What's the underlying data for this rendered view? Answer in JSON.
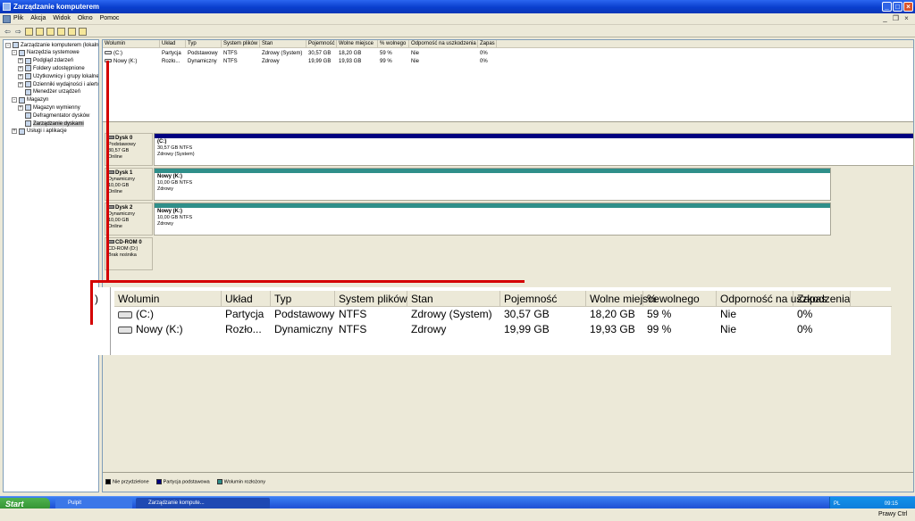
{
  "window": {
    "title": "Zarządzanie komputerem"
  },
  "menu": [
    "Plik",
    "Akcja",
    "Widok",
    "Okno",
    "Pomoc"
  ],
  "tree": [
    {
      "label": "Zarządzanie komputerem (lokalne)",
      "level": 0,
      "expander": "-"
    },
    {
      "label": "Narzędzia systemowe",
      "level": 1,
      "expander": "-"
    },
    {
      "label": "Podgląd zdarzeń",
      "level": 2,
      "expander": "+"
    },
    {
      "label": "Foldery udostępnione",
      "level": 2,
      "expander": "+"
    },
    {
      "label": "Użytkownicy i grupy lokalne",
      "level": 2,
      "expander": "+"
    },
    {
      "label": "Dzienniki wydajności i alertów",
      "level": 2,
      "expander": "+"
    },
    {
      "label": "Menedżer urządzeń",
      "level": 2,
      "expander": ""
    },
    {
      "label": "Magazyn",
      "level": 1,
      "expander": "-"
    },
    {
      "label": "Magazyn wymienny",
      "level": 2,
      "expander": "+"
    },
    {
      "label": "Defragmentator dysków",
      "level": 2,
      "expander": ""
    },
    {
      "label": "Zarządzanie dyskami",
      "level": 2,
      "expander": "",
      "selected": true
    },
    {
      "label": "Usługi i aplikacje",
      "level": 1,
      "expander": "+"
    }
  ],
  "volume_columns": [
    "Wolumin",
    "Układ",
    "Typ",
    "System plików",
    "Stan",
    "Pojemność",
    "Wolne miejsce",
    "% wolnego",
    "Odporność na uszkodzenia",
    "Zapas"
  ],
  "volumes": [
    [
      "(C:)",
      "Partycja",
      "Podstawowy",
      "NTFS",
      "Zdrowy (System)",
      "30,57 GB",
      "18,20 GB",
      "59 %",
      "Nie",
      "0%"
    ],
    [
      "Nowy (K:)",
      "Rozło...",
      "Dynamiczny",
      "NTFS",
      "Zdrowy",
      "19,99 GB",
      "19,93 GB",
      "99 %",
      "Nie",
      "0%"
    ]
  ],
  "disks": [
    {
      "name": "Dysk 0",
      "type": "Podstawowy",
      "size": "30,57 GB",
      "status": "Online",
      "part_title": "(C:)",
      "part_size": "30,57 GB NTFS",
      "part_status": "Zdrowy (System)",
      "bar_color": "#000080"
    },
    {
      "name": "Dysk 1",
      "type": "Dynamiczny",
      "size": "10,00 GB",
      "status": "Online",
      "part_title": "Nowy  (K:)",
      "part_size": "10,00 GB NTFS",
      "part_status": "Zdrowy",
      "bar_color": "#2f8f8a"
    },
    {
      "name": "Dysk 2",
      "type": "Dynamiczny",
      "size": "10,00 GB",
      "status": "Online",
      "part_title": "Nowy  (K:)",
      "part_size": "10,00 GB NTFS",
      "part_status": "Zdrowy",
      "bar_color": "#2f8f8a"
    },
    {
      "name": "CD-ROM 0",
      "type": "CD-ROM (D:)",
      "size": "",
      "status": "Brak nośnika"
    }
  ],
  "legend": [
    {
      "label": "Nie przydzielone",
      "color": "#000000"
    },
    {
      "label": "Partycja podstawowa",
      "color": "#000080"
    },
    {
      "label": "Wolumin rozłożony",
      "color": "#2f8f8a"
    }
  ],
  "zoom": {
    "left_glyph": ")",
    "columns": [
      "Wolumin",
      "Układ",
      "Typ",
      "System plików",
      "Stan",
      "Pojemność",
      "Wolne miejsce",
      "% wolnego",
      "Odporność na uszkodzenia",
      "Zapas"
    ],
    "rows": [
      [
        "(C:)",
        "Partycja",
        "Podstawowy",
        "NTFS",
        "Zdrowy (System)",
        "30,57 GB",
        "18,20 GB",
        "59 %",
        "Nie",
        "0%"
      ],
      [
        "Nowy (K:)",
        "Rozło...",
        "Dynamiczny",
        "NTFS",
        "Zdrowy",
        "19,99 GB",
        "19,93 GB",
        "99 %",
        "Nie",
        "0%"
      ]
    ]
  },
  "taskbar": {
    "start": "Start",
    "buttons": [
      "Pulpit",
      "Zarządzanie kompute..."
    ],
    "lang": "PL",
    "clock": "09:15",
    "keyboard": "Prawy Ctrl"
  },
  "colors": {
    "accent": "#0a3fce",
    "highlight": "#d40000"
  }
}
